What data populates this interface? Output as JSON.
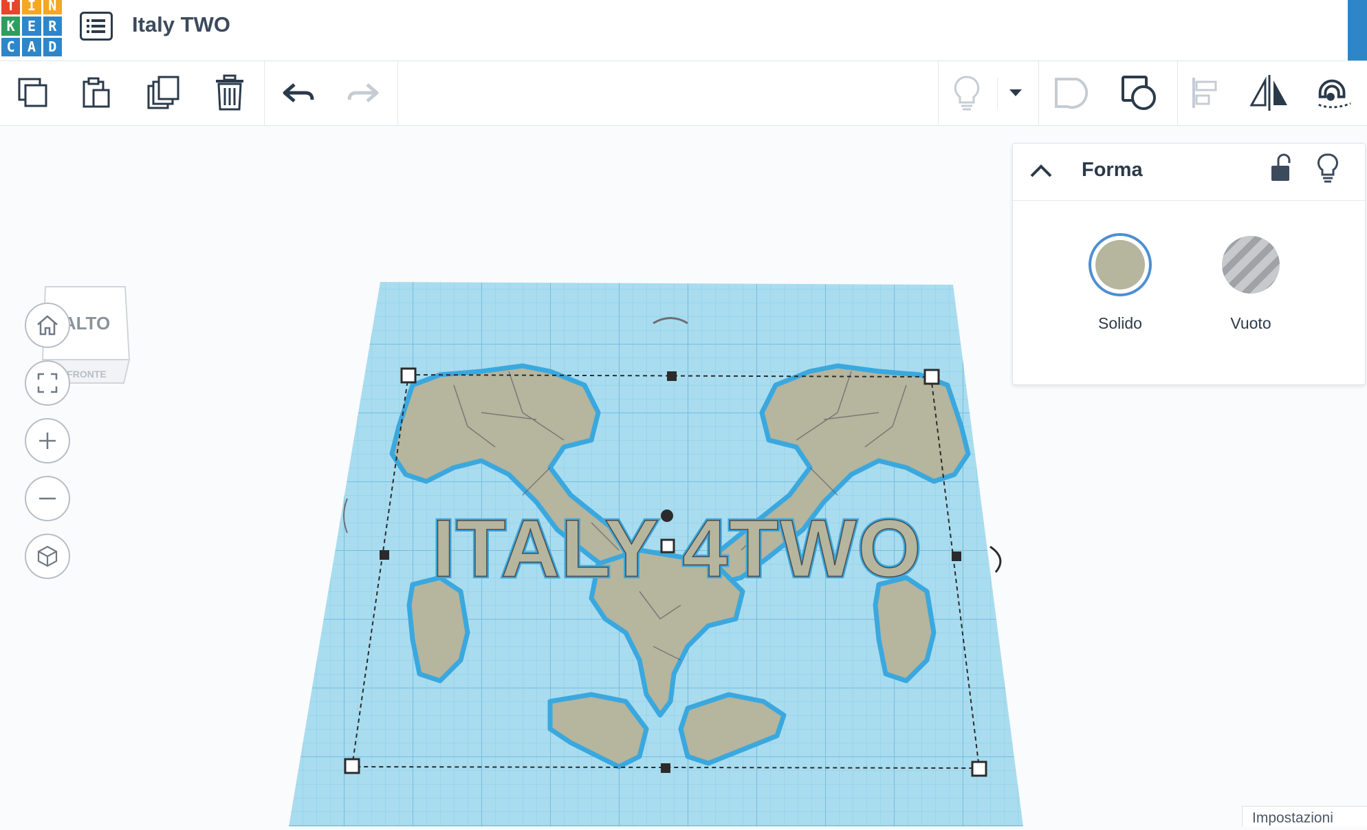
{
  "app": {
    "logo_letters": [
      "T",
      "I",
      "N",
      "K",
      "E",
      "R",
      "C",
      "A",
      "D"
    ],
    "logo_colors": [
      "#e8452c",
      "#f5a623",
      "#f5a623",
      "#2e8b57",
      "#2e86c9",
      "#2e86c9",
      "#2e86c9",
      "#2e86c9",
      "#2e86c9"
    ],
    "project_title": "Italy TWO"
  },
  "toolbar": {
    "left_tools": [
      "copy-icon",
      "paste-icon",
      "duplicate-icon",
      "delete-icon",
      "undo-icon",
      "redo-icon"
    ],
    "right_tools": [
      "note-icon",
      "chevron-down-icon",
      "group-icon",
      "ungroup-icon",
      "align-icon",
      "mirror-icon",
      "snap-icon"
    ]
  },
  "viewcube": {
    "top_label": "ALTO",
    "front_label": "FRONTE"
  },
  "nav": [
    "home-icon",
    "fit-view-icon",
    "zoom-in-icon",
    "zoom-out-icon",
    "perspective-icon"
  ],
  "workplane": {
    "model_text": "ITALY 4TWO",
    "colors": {
      "plane": "#a8d9ee",
      "grid": "#7fc4e2",
      "shape": "#b6b59d",
      "shape_outline": "#3aa8de"
    }
  },
  "panel": {
    "title": "Forma",
    "solid_label": "Solido",
    "hole_label": "Vuoto",
    "solid_color": "#b6b59d",
    "accent": "#4d8fd1"
  },
  "footer": {
    "settings_label": "Impostazioni"
  }
}
